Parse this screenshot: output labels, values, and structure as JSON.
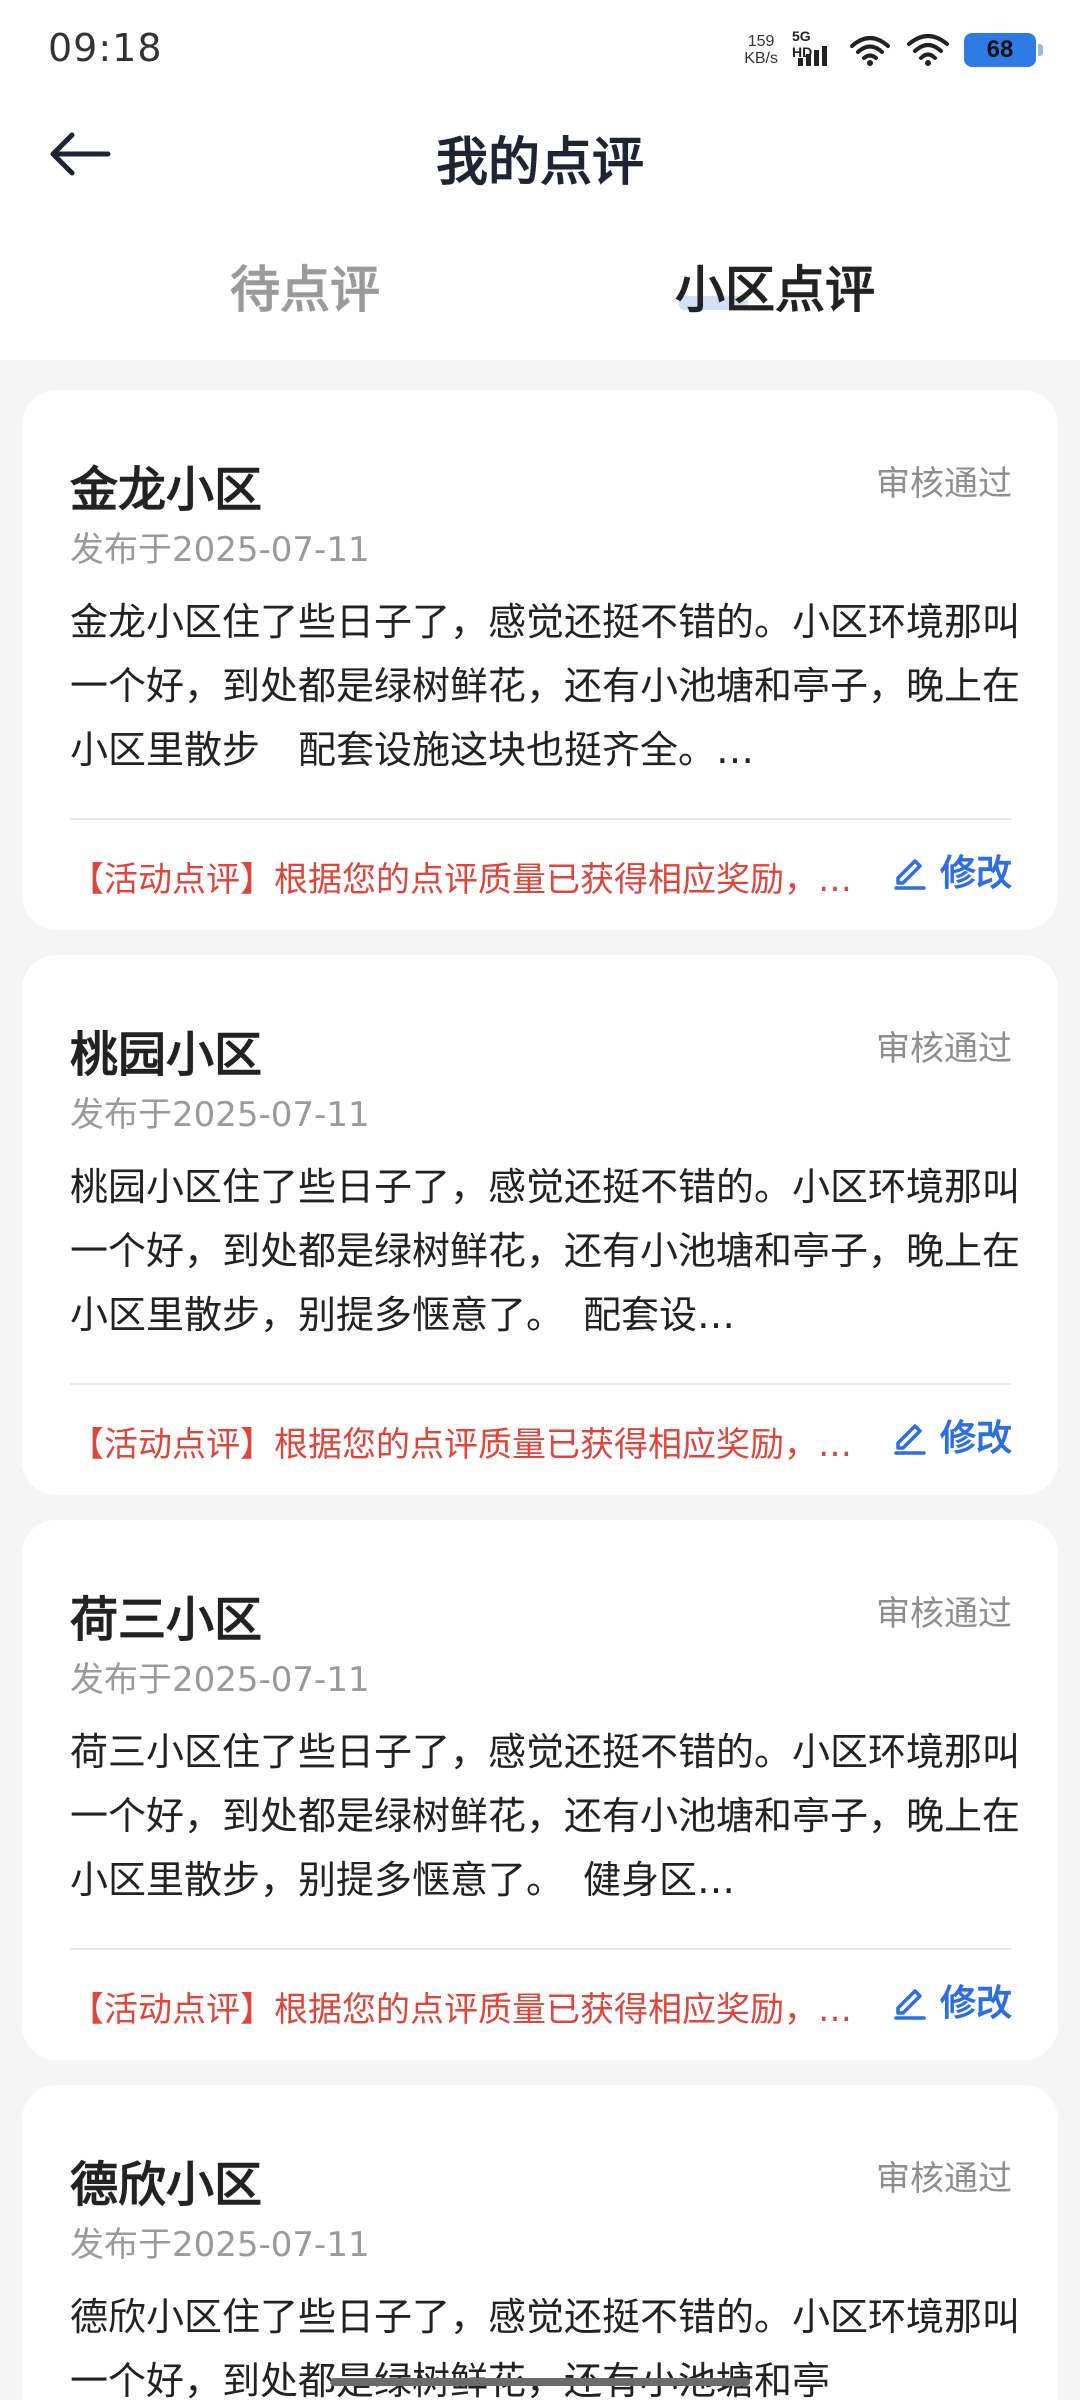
{
  "status_bar": {
    "time": "09:18",
    "net_speed_value": "159",
    "net_speed_unit": "KB/s",
    "signal_label": "5G HD",
    "battery": "68"
  },
  "header": {
    "title": "我的点评",
    "back_icon": "arrow-left-icon"
  },
  "tabs": [
    {
      "label": "待点评",
      "active": false
    },
    {
      "label": "小区点评",
      "active": true
    }
  ],
  "reviews": [
    {
      "name": "金龙小区",
      "status": "审核通过",
      "date": "发布于2025-07-11",
      "content": "金龙小区住了些日子了，感觉还挺不错的。小区环境那叫一个好，到处都是绿树鲜花，还有小池塘和亭子，晚上在小区里散步　配套设施这块也挺齐全。…",
      "notice": "【活动点评】根据您的点评质量已获得相应奖励，…",
      "edit_label": "修改"
    },
    {
      "name": "桃园小区",
      "status": "审核通过",
      "date": "发布于2025-07-11",
      "content": "桃园小区住了些日子了，感觉还挺不错的。小区环境那叫一个好，到处都是绿树鲜花，还有小池塘和亭子，晚上在小区里散步，别提多惬意了。　配套设…",
      "notice": "【活动点评】根据您的点评质量已获得相应奖励，…",
      "edit_label": "修改"
    },
    {
      "name": "荷三小区",
      "status": "审核通过",
      "date": "发布于2025-07-11",
      "content": "荷三小区住了些日子了，感觉还挺不错的。小区环境那叫一个好，到处都是绿树鲜花，还有小池塘和亭子，晚上在小区里散步，别提多惬意了。　健身区…",
      "notice": "【活动点评】根据您的点评质量已获得相应奖励，…",
      "edit_label": "修改"
    },
    {
      "name": "德欣小区",
      "status": "审核通过",
      "date": "发布于2025-07-11",
      "content": "德欣小区住了些日子了，感觉还挺不错的。小区环境那叫一个好，到处都是绿树鲜花，还有小池塘和亭",
      "notice": "",
      "edit_label": ""
    }
  ],
  "colors": {
    "accent_blue": "#2d6ee0",
    "notice_red": "#e0453c",
    "status_gray": "#8e8e8e"
  }
}
